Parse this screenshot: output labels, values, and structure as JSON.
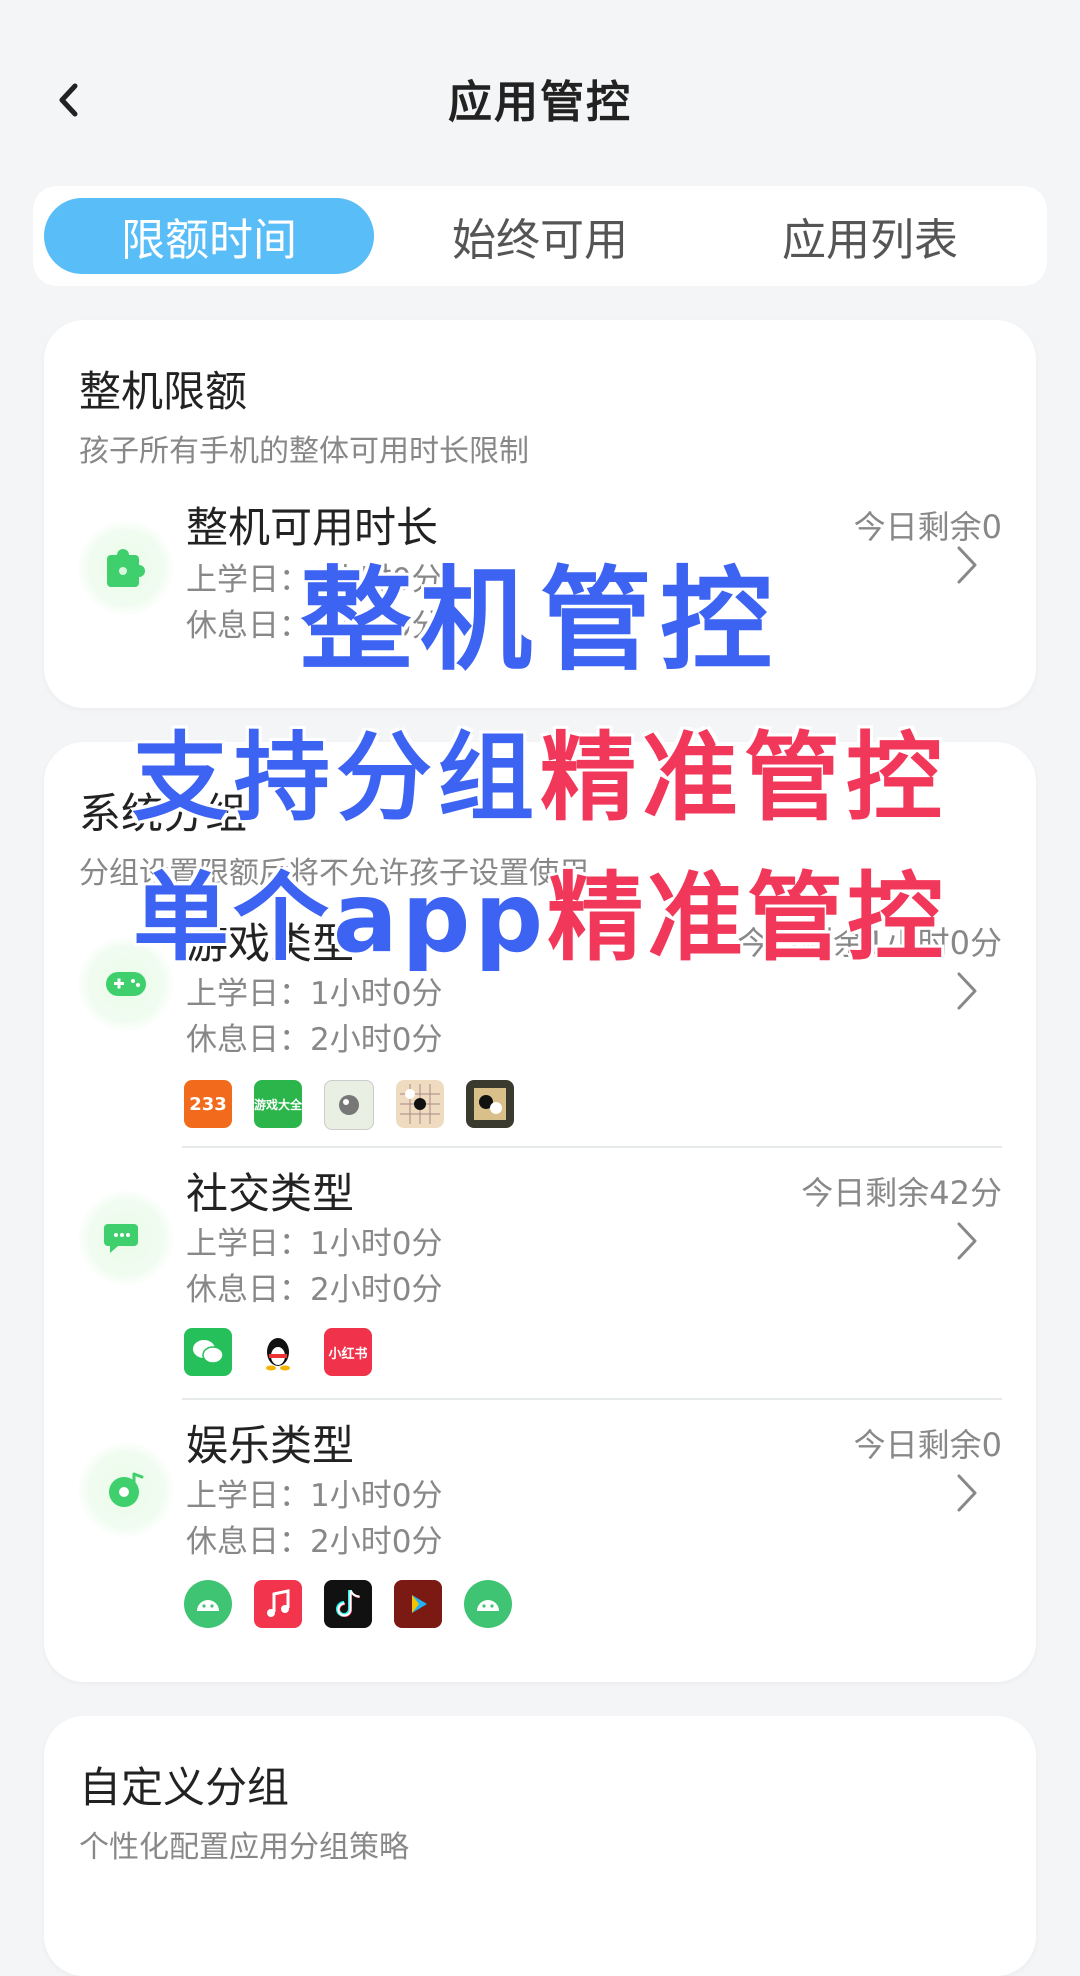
{
  "header": {
    "title": "应用管控"
  },
  "tabs": [
    {
      "label": "限额时间",
      "active": true
    },
    {
      "label": "始终可用",
      "active": false
    },
    {
      "label": "应用列表",
      "active": false
    }
  ],
  "whole_device": {
    "title": "整机限额",
    "subtitle": "孩子所有手机的整体可用时长限制",
    "item": {
      "name": "整机可用时长",
      "remain": "今日剩余0",
      "school_day": "上学日：1小时0分",
      "rest_day": "休息日：1小时0分",
      "icon": "puzzle-icon"
    }
  },
  "system_groups": {
    "title": "系统分组",
    "subtitle": "分组设置限额后将不允许孩子设置使用",
    "items": [
      {
        "name": "游戏类型",
        "remain": "今日剩余1小时0分",
        "school_day": "上学日：1小时0分",
        "rest_day": "休息日：2小时0分",
        "icon": "gamepad-icon",
        "apps": [
          {
            "label": "233",
            "color": "#f26a1b"
          },
          {
            "label": "游戏大全",
            "color": "#2bb54b"
          },
          {
            "label": "",
            "color": "#e9efe3"
          },
          {
            "label": "",
            "color": "#efdcc0"
          },
          {
            "label": "",
            "color": "#3b3a2f"
          }
        ]
      },
      {
        "name": "社交类型",
        "remain": "今日剩余42分",
        "school_day": "上学日：1小时0分",
        "rest_day": "休息日：2小时0分",
        "icon": "chat-icon",
        "apps": [
          {
            "label": "",
            "color": "#25c05a"
          },
          {
            "label": "",
            "color": "#ffffff"
          },
          {
            "label": "小红书",
            "color": "#f0334a"
          }
        ]
      },
      {
        "name": "娱乐类型",
        "remain": "今日剩余0",
        "school_day": "上学日：1小时0分",
        "rest_day": "休息日：2小时0分",
        "icon": "music-disc-icon",
        "apps": [
          {
            "label": "",
            "color": "#3ec473"
          },
          {
            "label": "",
            "color": "#f3344d"
          },
          {
            "label": "",
            "color": "#111111"
          },
          {
            "label": "",
            "color": "#7a1a12"
          },
          {
            "label": "",
            "color": "#3ec473"
          }
        ]
      }
    ]
  },
  "custom_groups": {
    "title": "自定义分组",
    "subtitle": "个性化配置应用分组策略"
  },
  "promo_overlay": {
    "line1": "整机管控",
    "line2_blue": "支持分组",
    "line2_red": "精准管控",
    "line3_blue": "单个app",
    "line3_red": "精准管控"
  }
}
